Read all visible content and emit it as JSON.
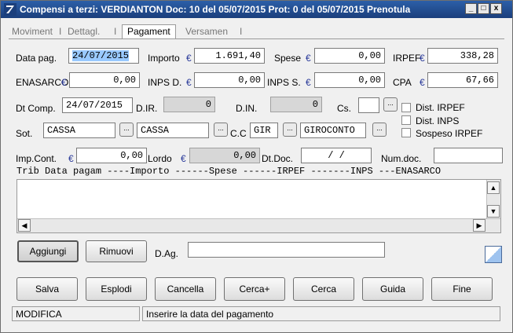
{
  "window": {
    "title": "Compensi a terzi: VERDIANTON Doc: 10       del 05/07/2015 Prot:      0 del 05/07/2015 Prenotula",
    "minimize": "_",
    "maximize": "□",
    "close": "x"
  },
  "tabs": [
    "Moviment",
    "Dettagl.",
    "Pagament",
    "Versamen"
  ],
  "currency_symbol": "€",
  "form": {
    "data_pag": {
      "label": "Data pag.",
      "value": "24/07/2015"
    },
    "importo": {
      "label": "Importo",
      "value": "1.691,40"
    },
    "spese": {
      "label": "Spese",
      "value": "0,00"
    },
    "irpef": {
      "label": "IRPEF",
      "value": "338,28"
    },
    "enasarco": {
      "label": "ENASARCO",
      "value": "0,00"
    },
    "inps_d": {
      "label": "INPS D.",
      "value": "0,00"
    },
    "inps_s": {
      "label": "INPS S.",
      "value": "0,00"
    },
    "cpa": {
      "label": "CPA",
      "value": "67,66"
    },
    "dt_comp": {
      "label": "Dt Comp.",
      "value": "24/07/2015"
    },
    "d_ir": {
      "label": "D.IR.",
      "value": "0"
    },
    "d_in": {
      "label": "D.IN.",
      "value": "0"
    },
    "cs": {
      "label": "Cs.",
      "value": ""
    },
    "sot": {
      "label": "Sot.",
      "code": "CASSA",
      "desc": "CASSA"
    },
    "cc": {
      "label": "C.C",
      "code": "GIR",
      "desc": "GIROCONTO"
    },
    "imp_cont": {
      "label": "Imp.Cont.",
      "value": "0,00"
    },
    "lordo": {
      "label": "Lordo",
      "value": "0,00"
    },
    "dt_doc": {
      "label": "Dt.Doc.",
      "value": "/  /"
    },
    "num_doc": {
      "label": "Num.doc.",
      "value": ""
    },
    "d_ag": {
      "label": "D.Ag.",
      "value": ""
    }
  },
  "checkboxes": {
    "dist_irpef": "Dist. IRPEF",
    "dist_inps": "Dist. INPS",
    "sospeso_irpef": "Sospeso IRPEF"
  },
  "browse_label": "...",
  "list_header": "Trib Data pagam ----Importo ------Spese ------IRPEF -------INPS ---ENASARCO",
  "list_buttons": {
    "aggiungi": "Aggiungi",
    "rimuovi": "Rimuovi"
  },
  "buttons": [
    "Salva",
    "Esplodi",
    "Cancella",
    "Cerca+",
    "Cerca",
    "Guida",
    "Fine"
  ],
  "status": {
    "mode": "MODIFICA",
    "message": "Inserire la data del pagamento"
  }
}
